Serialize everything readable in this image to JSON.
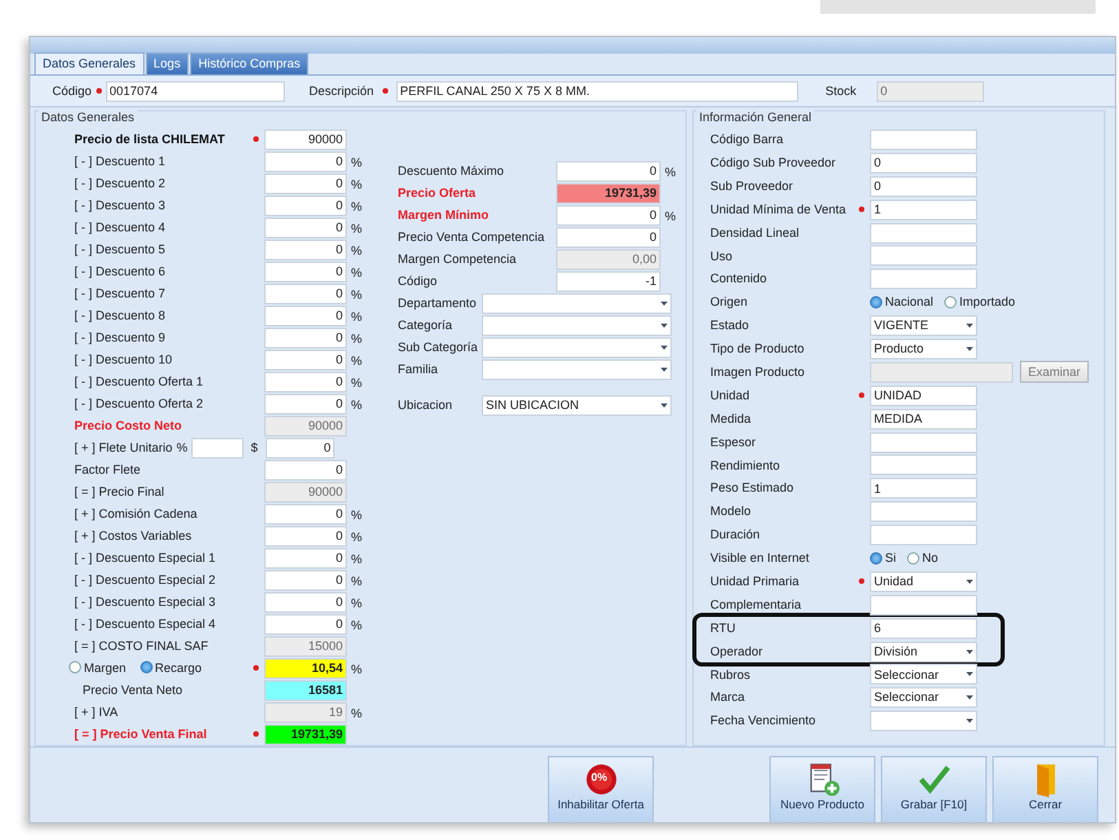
{
  "tabs": [
    {
      "label": "Datos Generales",
      "selected": true
    },
    {
      "label": "Logs",
      "selected": false
    },
    {
      "label": "Histórico Compras",
      "selected": false
    }
  ],
  "header": {
    "code_label": "Código",
    "code_required": true,
    "code_value": "0017074",
    "description_label": "Descripción",
    "description_required": true,
    "description_value": "PERFIL CANAL 250 X 75 X 8 MM.",
    "stock_label": "Stock",
    "stock_value": "0",
    "stock_disabled": true
  },
  "pricing": {
    "title": "Datos Generales",
    "rows": [
      {
        "kind": "field",
        "label": "Precio de lista CHILEMAT",
        "bold": true,
        "alert": false,
        "required": true,
        "value": "90000",
        "disabled": false
      },
      {
        "kind": "field",
        "label": "[ - ] Descuento 1",
        "bold": false,
        "alert": false,
        "required": false,
        "value": "0",
        "unit": "%",
        "disabled": false
      },
      {
        "kind": "field",
        "label": "[ - ] Descuento 2",
        "bold": false,
        "alert": false,
        "required": false,
        "value": "0",
        "unit": "%",
        "disabled": false
      },
      {
        "kind": "field",
        "label": "[ - ] Descuento 3",
        "bold": false,
        "alert": false,
        "required": false,
        "value": "0",
        "unit": "%",
        "disabled": false
      },
      {
        "kind": "field",
        "label": "[ - ] Descuento 4",
        "bold": false,
        "alert": false,
        "required": false,
        "value": "0",
        "unit": "%",
        "disabled": false
      },
      {
        "kind": "field",
        "label": "[ - ] Descuento 5",
        "bold": false,
        "alert": false,
        "required": false,
        "value": "0",
        "unit": "%",
        "disabled": false
      },
      {
        "kind": "field",
        "label": "[ - ] Descuento 6",
        "bold": false,
        "alert": false,
        "required": false,
        "value": "0",
        "unit": "%",
        "disabled": false
      },
      {
        "kind": "field",
        "label": "[ - ] Descuento 7",
        "bold": false,
        "alert": false,
        "required": false,
        "value": "0",
        "unit": "%",
        "disabled": false
      },
      {
        "kind": "field",
        "label": "[ - ] Descuento 8",
        "bold": false,
        "alert": false,
        "required": false,
        "value": "0",
        "unit": "%",
        "disabled": false
      },
      {
        "kind": "field",
        "label": "[ - ] Descuento 9",
        "bold": false,
        "alert": false,
        "required": false,
        "value": "0",
        "unit": "%",
        "disabled": false
      },
      {
        "kind": "field",
        "label": "[ - ] Descuento 10",
        "bold": false,
        "alert": false,
        "required": false,
        "value": "0",
        "unit": "%",
        "disabled": false
      },
      {
        "kind": "field",
        "label": "[ - ] Descuento Oferta 1",
        "bold": false,
        "alert": false,
        "required": false,
        "value": "0",
        "unit": "%",
        "disabled": false
      },
      {
        "kind": "field",
        "label": "[ - ] Descuento Oferta 2",
        "bold": false,
        "alert": false,
        "required": false,
        "value": "0",
        "unit": "%",
        "disabled": false
      },
      {
        "kind": "field",
        "label": "Precio Costo Neto",
        "bold": true,
        "alert": true,
        "required": false,
        "value": "90000",
        "disabled": true
      },
      {
        "kind": "freight",
        "label": "[ + ] Flete Unitario",
        "unit": "%",
        "symbol": "$",
        "value": "0"
      },
      {
        "kind": "field",
        "label": "Factor Flete",
        "bold": false,
        "alert": false,
        "required": false,
        "value": "0",
        "disabled": false
      },
      {
        "kind": "field",
        "label": "[ = ] Precio Final",
        "bold": false,
        "alert": false,
        "required": false,
        "value": "90000",
        "disabled": true
      },
      {
        "kind": "field",
        "label": "[ + ] Comisión Cadena",
        "bold": false,
        "alert": false,
        "required": false,
        "value": "0",
        "unit": "%",
        "disabled": false
      },
      {
        "kind": "field",
        "label": "[ + ] Costos Variables",
        "bold": false,
        "alert": false,
        "required": false,
        "value": "0",
        "unit": "%",
        "disabled": false
      },
      {
        "kind": "field",
        "label": "[ - ] Descuento Especial 1",
        "bold": false,
        "alert": false,
        "required": false,
        "value": "0",
        "unit": "%",
        "disabled": false
      },
      {
        "kind": "field",
        "label": "[ - ] Descuento Especial 2",
        "bold": false,
        "alert": false,
        "required": false,
        "value": "0",
        "unit": "%",
        "disabled": false
      },
      {
        "kind": "field",
        "label": "[ - ] Descuento Especial 3",
        "bold": false,
        "alert": false,
        "required": false,
        "value": "0",
        "unit": "%",
        "disabled": false
      },
      {
        "kind": "field",
        "label": "[ - ] Descuento Especial 4",
        "bold": false,
        "alert": false,
        "required": false,
        "value": "0",
        "unit": "%",
        "disabled": false
      },
      {
        "kind": "field",
        "label": "[ = ] COSTO FINAL SAF",
        "bold": false,
        "alert": false,
        "required": false,
        "value": "15000",
        "disabled": true
      },
      {
        "kind": "choice",
        "options": [
          {
            "label": "Margen",
            "selected": false
          },
          {
            "label": "Recargo",
            "selected": true
          }
        ],
        "required": true,
        "value": "10,54",
        "unit": "%",
        "color": "#ffff00"
      },
      {
        "kind": "field",
        "label": "Precio Venta Neto",
        "bold": false,
        "alert": false,
        "required": false,
        "value": "16581",
        "disabled": false,
        "color": "#80ffff"
      },
      {
        "kind": "field",
        "label": "[ + ] IVA",
        "bold": false,
        "alert": false,
        "required": false,
        "value": "19",
        "unit": "%",
        "disabled": true
      },
      {
        "kind": "field",
        "label": "[ = ] Precio Venta Final",
        "bold": true,
        "alert": true,
        "required": true,
        "value": "19731,39",
        "disabled": false,
        "color": "#00ff00"
      }
    ]
  },
  "commercial": {
    "rows": [
      {
        "label": "Descuento Máximo",
        "alert": false,
        "value": "0",
        "unit": "%",
        "disabled": false
      },
      {
        "label": "Precio Oferta",
        "alert": true,
        "value": "19731,39",
        "disabled": false,
        "color": "#f47f7f"
      },
      {
        "label": "Margen Mínimo",
        "alert": true,
        "value": "0",
        "unit": "%",
        "disabled": false
      },
      {
        "label": "Precio Venta Competencia",
        "alert": false,
        "value": "0",
        "disabled": false
      },
      {
        "label": "Margen Competencia",
        "alert": false,
        "value": "0,00",
        "disabled": true
      },
      {
        "label": "Código",
        "alert": false,
        "value": "-1",
        "disabled": false
      }
    ],
    "selects": [
      {
        "label": "Departamento"
      },
      {
        "label": "Categoría"
      },
      {
        "label": "Sub Categoría"
      },
      {
        "label": "Familia"
      }
    ],
    "location": {
      "label": "Ubicacion",
      "value": "SIN UBICACION"
    }
  },
  "general_info": {
    "title": "Información General",
    "rows": [
      {
        "kind": "text",
        "label": "Código Barra",
        "required": false,
        "highlighted": false
      },
      {
        "kind": "text",
        "label": "Código Sub Proveedor",
        "required": false,
        "highlighted": false,
        "value": "0"
      },
      {
        "kind": "text",
        "label": "Sub Proveedor",
        "required": false,
        "highlighted": false,
        "value": "0"
      },
      {
        "kind": "text",
        "label": "Unidad Mínima de Venta",
        "required": true,
        "highlighted": false,
        "value": "1"
      },
      {
        "kind": "text",
        "label": "Densidad Lineal",
        "required": false,
        "highlighted": false
      },
      {
        "kind": "text",
        "label": "Uso",
        "required": false,
        "highlighted": false
      },
      {
        "kind": "text",
        "label": "Contenido",
        "required": false,
        "highlighted": false
      },
      {
        "kind": "radio",
        "label": "Origen",
        "required": false,
        "highlighted": false,
        "options": [
          {
            "label": "Nacional",
            "selected": true
          },
          {
            "label": "Importado",
            "selected": false
          }
        ]
      },
      {
        "kind": "select",
        "label": "Estado",
        "required": false,
        "highlighted": false,
        "value": "VIGENTE"
      },
      {
        "kind": "select",
        "label": "Tipo de Producto",
        "required": false,
        "highlighted": false,
        "value": "Producto"
      },
      {
        "kind": "file",
        "label": "Imagen Producto",
        "required": false,
        "highlighted": false,
        "button": "Examinar"
      },
      {
        "kind": "text",
        "label": "Unidad",
        "required": true,
        "highlighted": false,
        "value": "UNIDAD"
      },
      {
        "kind": "text",
        "label": "Medida",
        "required": false,
        "highlighted": false,
        "value": "MEDIDA"
      },
      {
        "kind": "text",
        "label": "Espesor",
        "required": false,
        "highlighted": false
      },
      {
        "kind": "text",
        "label": "Rendimiento",
        "required": false,
        "highlighted": false
      },
      {
        "kind": "text",
        "label": "Peso Estimado",
        "required": false,
        "highlighted": false,
        "value": "1"
      },
      {
        "kind": "text",
        "label": "Modelo",
        "required": false,
        "highlighted": false
      },
      {
        "kind": "text",
        "label": "Duración",
        "required": false,
        "highlighted": false
      },
      {
        "kind": "radio",
        "label": "Visible en Internet",
        "required": false,
        "highlighted": false,
        "options": [
          {
            "label": "Si",
            "selected": true
          },
          {
            "label": "No",
            "selected": false
          }
        ]
      },
      {
        "kind": "select",
        "label": "Unidad Primaria",
        "required": true,
        "highlighted": false,
        "value": "Unidad"
      },
      {
        "kind": "text",
        "label": "Complementaria",
        "required": false,
        "highlighted": false
      },
      {
        "kind": "text",
        "label": "RTU",
        "required": false,
        "highlighted": true,
        "value": "6"
      },
      {
        "kind": "select",
        "label": "Operador",
        "required": false,
        "highlighted": true,
        "value": "División"
      },
      {
        "kind": "select",
        "label": "Rubros",
        "required": false,
        "highlighted": false,
        "value": "Seleccionar"
      },
      {
        "kind": "select",
        "label": "Marca",
        "required": false,
        "highlighted": false,
        "value": "Seleccionar"
      },
      {
        "kind": "select",
        "label": "Fecha Vencimiento",
        "required": false,
        "highlighted": false
      }
    ]
  },
  "buttons": [
    {
      "kind": "discount",
      "label": "Inhabilitar Oferta",
      "icon_text": "0%"
    },
    {
      "kind": "new",
      "label": "Nuevo Producto"
    },
    {
      "kind": "save",
      "label": "Grabar [F10]"
    },
    {
      "kind": "close",
      "label": "Cerrar"
    }
  ]
}
